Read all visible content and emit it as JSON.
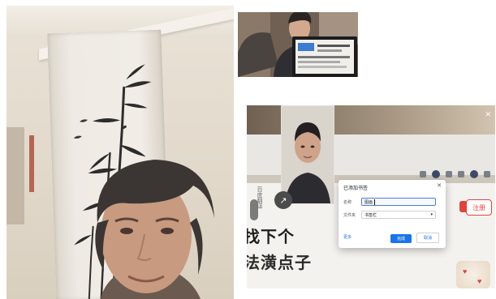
{
  "photos": {
    "left": {
      "subject": "elderly woman",
      "scroll": "bamboo painting"
    },
    "top_right": {
      "subject": "man holding laptop"
    },
    "bottom_right": {
      "screen": {
        "dialog": {
          "title": "已添加书签",
          "close_icon": "close-icon",
          "name_label": "名称",
          "name_value": "图画",
          "folder_label": "文件夹",
          "folder_value": "书签栏",
          "more_label": "更多",
          "done_label": "完成",
          "cancel_label": "取消"
        },
        "register_label": "注册",
        "vertical_label": "百度翻译",
        "line1": "找下个",
        "line2": "法潢点子"
      }
    }
  },
  "colors": {
    "accent_blue": "#1a73e8",
    "accent_red": "#e0443b",
    "background": "#ffffff"
  }
}
